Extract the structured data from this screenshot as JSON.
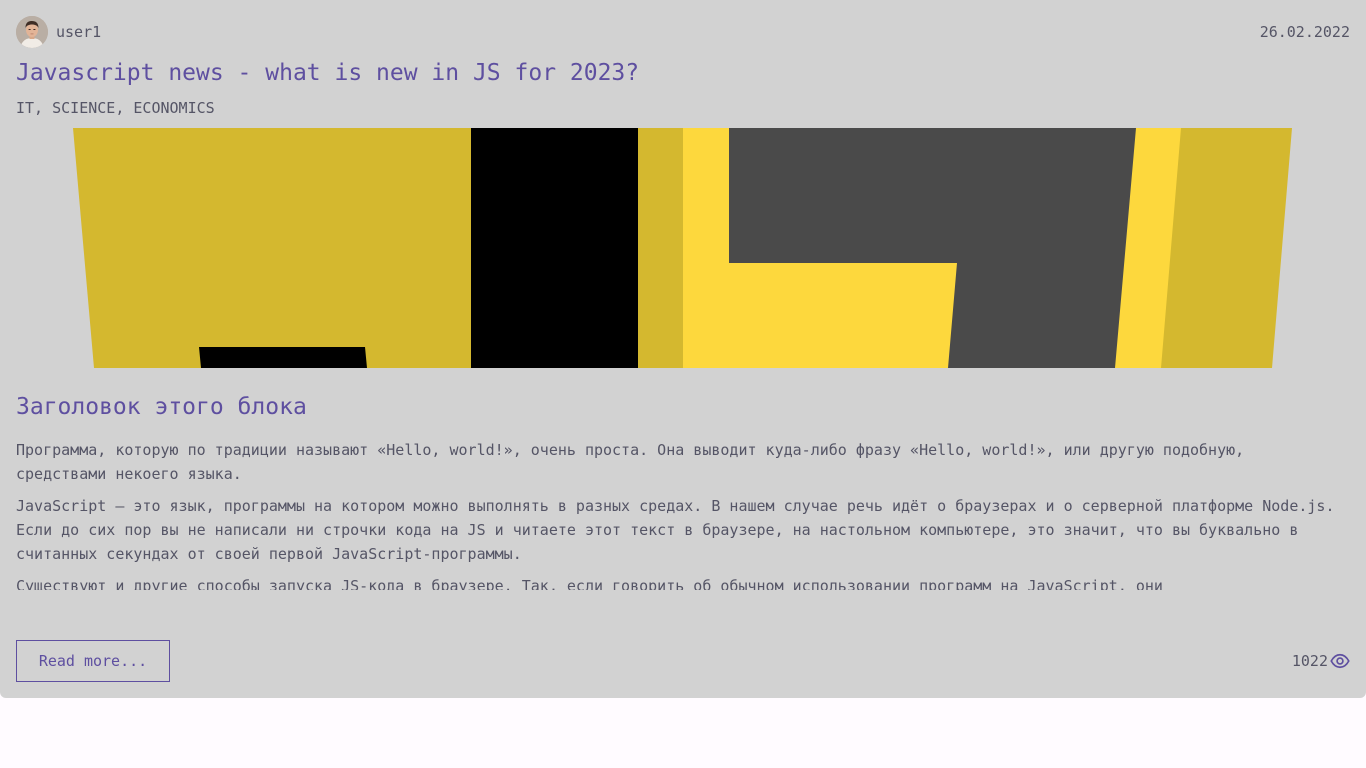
{
  "post": {
    "author": {
      "username": "user1",
      "avatar_icon": "user-avatar"
    },
    "date": "26.02.2022",
    "title": "Javascript news - what is new in JS for 2023?",
    "tags": "IT, SCIENCE, ECONOMICS",
    "hero_image": "js-logo-banner",
    "block_heading": "Заголовок этого блока",
    "paragraphs": [
      "Программа, которую по традиции называют «Hello, world!», очень проста. Она выводит куда-либо фразу «Hello, world!», или другую подобную, средствами некоего языка.",
      "JavaScript — это язык, программы на котором можно выполнять в разных средах. В нашем случае речь идёт о браузерах и о серверной платформе Node.js. Если до сих пор вы не написали ни строчки кода на JS и читаете этот текст в браузере, на настольном компьютере, это значит, что вы буквально в считанных секундах от своей первой JavaScript-программы.",
      "Существуют и другие способы запуска JS-кода в браузере. Так, если говорить об обычном использовании программ на JavaScript, они"
    ],
    "read_more_label": "Read more...",
    "views": "1022",
    "views_icon": "eye-icon"
  },
  "colors": {
    "card_background": "#d2d2d2",
    "accent": "#5e4fa0",
    "text": "#555566",
    "page_background": "#fffbff"
  }
}
